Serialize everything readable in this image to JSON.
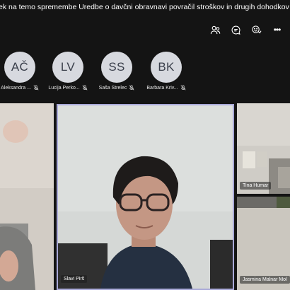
{
  "meeting": {
    "title": "ek na temo spremembe Uredbe o davčni obravnavi povračil stroškov in drugih dohodkov iz delovnega razmerj"
  },
  "toolbar": {
    "icons": [
      "participants-icon",
      "chat-icon",
      "reactions-icon",
      "more-icon"
    ],
    "more_label": "•••"
  },
  "roster": [
    {
      "initials": "AČ",
      "name": "Aleksandra ..."
    },
    {
      "initials": "LV",
      "name": "Lucija Perko..."
    },
    {
      "initials": "SS",
      "name": "Saša Strelec"
    },
    {
      "initials": "BK",
      "name": "Barbara Kriv..."
    }
  ],
  "video_tiles": {
    "main": {
      "name": "Slavi Pirš"
    },
    "right_top": {
      "name": "Tina Humar"
    },
    "right_bottom": {
      "name": "Jasmina Malnar Mol"
    }
  },
  "colors": {
    "background": "#141414",
    "avatar_bg": "#d7d9df",
    "avatar_text": "#3a3f4b",
    "active_speaker_border": "#a9a9d8"
  }
}
